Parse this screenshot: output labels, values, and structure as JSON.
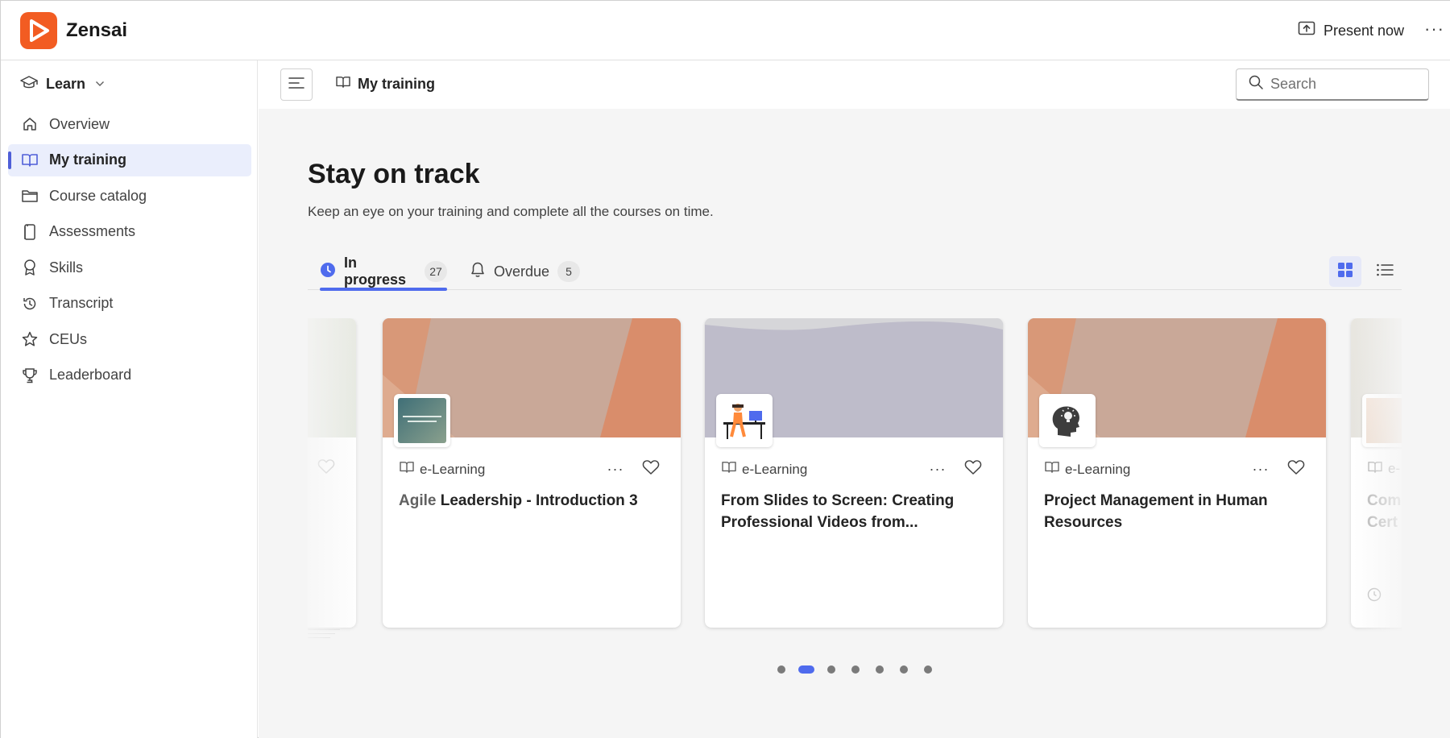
{
  "app": {
    "name": "Zensai",
    "present_label": "Present now",
    "more_label": "···"
  },
  "sidebar": {
    "section_label": "Learn",
    "items": [
      {
        "label": "Overview",
        "icon": "home-icon",
        "active": false
      },
      {
        "label": "My training",
        "icon": "book-icon",
        "active": true
      },
      {
        "label": "Course catalog",
        "icon": "folder-icon",
        "active": false
      },
      {
        "label": "Assessments",
        "icon": "clipboard-icon",
        "active": false
      },
      {
        "label": "Skills",
        "icon": "ribbon-icon",
        "active": false
      },
      {
        "label": "Transcript",
        "icon": "history-icon",
        "active": false
      },
      {
        "label": "CEUs",
        "icon": "star-icon",
        "active": false
      },
      {
        "label": "Leaderboard",
        "icon": "trophy-icon",
        "active": false
      }
    ]
  },
  "header": {
    "breadcrumb": "My training",
    "search_placeholder": "Search"
  },
  "main": {
    "title": "Stay on track",
    "subtitle": "Keep an eye on your training and complete all the courses on time.",
    "tabs": [
      {
        "label": "In progress",
        "count": "27",
        "active": true
      },
      {
        "label": "Overdue",
        "count": "5",
        "active": false
      }
    ],
    "view": "grid"
  },
  "cards": [
    {
      "type": "e-Learning",
      "title_dim": "Agile",
      "title": "Leadership - Introduction 3",
      "more": "···"
    },
    {
      "type": "e-Learning",
      "title_dim": "",
      "title": "From Slides to Screen: Creating Professional Videos from...",
      "more": "···"
    },
    {
      "type": "e-Learning",
      "title_dim": "",
      "title": "Project Management in Human Resources",
      "more": "···"
    }
  ],
  "peek_right": {
    "type": "e-",
    "title": "Com Cert"
  },
  "pager": {
    "total": 7,
    "current": 2
  },
  "colors": {
    "brand": "#f25c22",
    "accent": "#4f6bed",
    "active_bg": "#eaeefc"
  }
}
